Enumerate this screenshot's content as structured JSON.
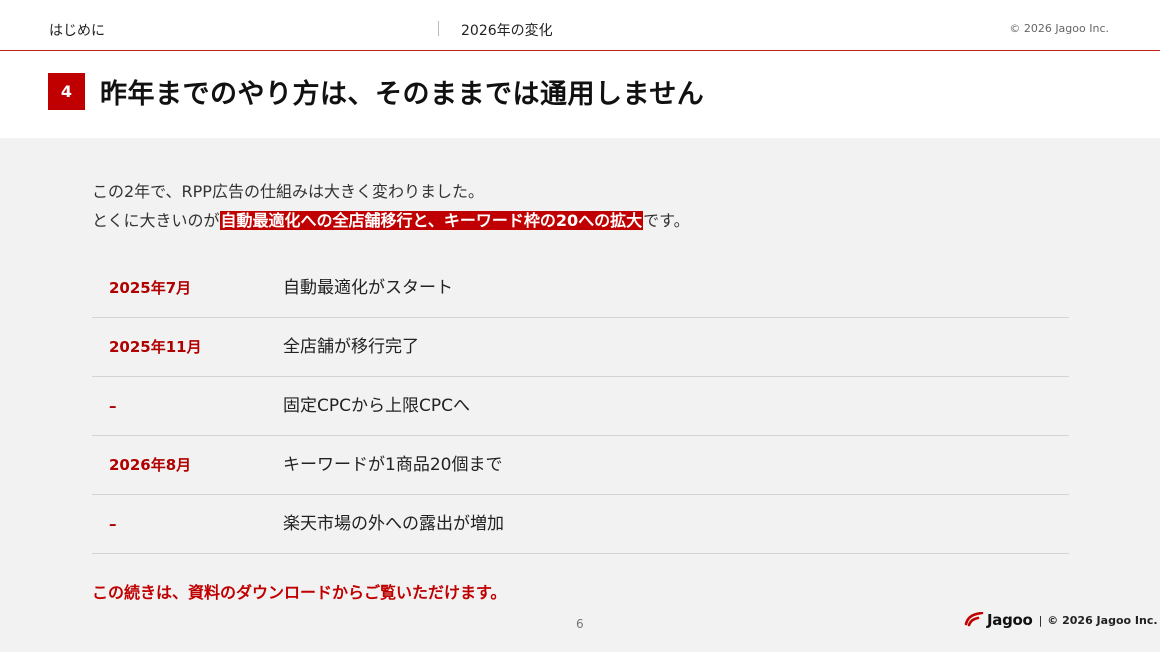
{
  "header": {
    "section": "はじめに",
    "subsection": "2026年の変化",
    "copyright": "© 2026 Jagoo Inc."
  },
  "title": {
    "number": "4",
    "text": "昨年までのやり方は、そのままでは通用しません"
  },
  "intro": {
    "line1": "この2年で、RPP広告の仕組みは大きく変わりました。",
    "line2_prefix": "とくに大きいのが",
    "line2_highlight": "自動最適化への全店舗移行と、キーワード枠の20への拡大",
    "line2_suffix": "です。"
  },
  "timeline": [
    {
      "date": "2025年7月",
      "text": "自動最適化がスタート"
    },
    {
      "date": "2025年11月",
      "text": "全店舗が移行完了"
    },
    {
      "date": "–",
      "text": "固定CPCから上限CPCへ"
    },
    {
      "date": "2026年8月",
      "text": "キーワードが1商品20個まで"
    },
    {
      "date": "–",
      "text": "楽天市場の外への露出が増加"
    }
  ],
  "cta": "この続きは、資料のダウンロードからご覧いただけます。",
  "page_number": "6",
  "footer": {
    "brand": "Jagoo",
    "separator": "|",
    "copyright": "© 2026 Jagoo Inc."
  },
  "colors": {
    "accent": "#c00000",
    "rule": "#c4201f",
    "background": "#f2f2f2"
  }
}
